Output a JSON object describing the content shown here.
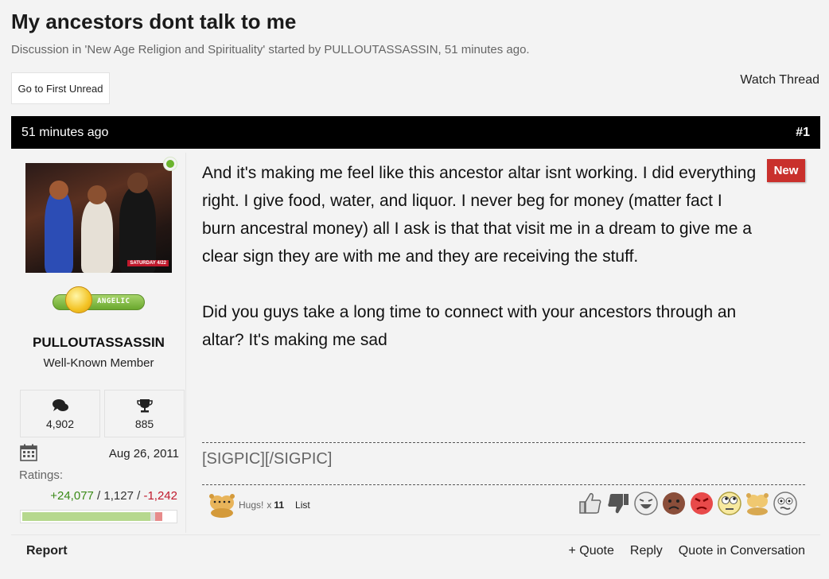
{
  "thread": {
    "title": "My ancestors dont talk to me",
    "description": "Discussion in 'New Age Religion and Spirituality' started by PULLOUTASSASSIN, 51 minutes ago.",
    "first_unread_label": "Go to First Unread",
    "watch_label": "Watch Thread"
  },
  "post": {
    "time": "51 minutes ago",
    "number": "#1",
    "new_badge": "New",
    "paragraphs": [
      "And it's making me feel like this ancestor altar isnt working. I did everything right. I give food, water, and liquor. I never beg for money (matter fact I burn ancestral money) all I ask is that that visit me in a dream to give me a clear sign they are with me and they are receiving the stuff.",
      "Did you guys take a long time to connect with your ancestors through an altar? It's making me sad"
    ],
    "signature": "[SIGPIC][/SIGPIC]",
    "hugs": {
      "label": "Hugs!",
      "times": "x",
      "count": "11",
      "list_label": "List"
    },
    "rating_icons": [
      "thumbs-up-icon",
      "thumbs-down-icon",
      "laughing-icon",
      "sad-face-icon",
      "angry-icon",
      "rolling-eyes-icon",
      "hug-bears-icon",
      "confused-icon"
    ],
    "footer": {
      "report": "Report",
      "quote": "+ Quote",
      "reply": "Reply",
      "quote_conversation": "Quote in Conversation"
    }
  },
  "user": {
    "name": "PULLOUTASSASSIN",
    "title": "Well-Known Member",
    "rank_badge": "ANGELIC",
    "avatar_tag": "SATURDAY 4/22",
    "messages": "4,902",
    "trophies": "885",
    "joined": "Aug 26, 2011",
    "ratings_label": "Ratings:",
    "ratings_positive": "+24,077",
    "ratings_neutral": "1,127",
    "ratings_negative": "-1,242",
    "ratings_sep": "/",
    "ratings_positive_fraction": 0.91,
    "online": true
  },
  "colors": {
    "header_bg": "#000000",
    "new_badge": "#c9302c",
    "positive": "#3a8a17",
    "negative": "#c0192c",
    "online": "#6bb42c"
  }
}
